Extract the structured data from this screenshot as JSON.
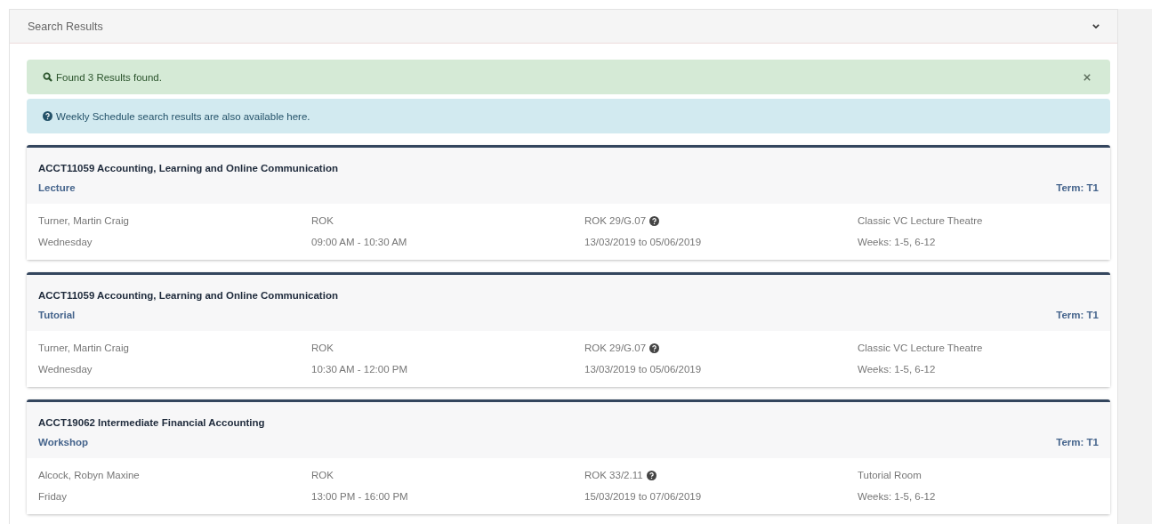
{
  "panel": {
    "title": "Search Results",
    "expanded": true
  },
  "alerts": [
    {
      "kind": "success",
      "text": "Found 3 Results found.",
      "dismissible": true
    },
    {
      "kind": "info",
      "text": "Weekly Schedule search results are also available here.",
      "dismissible": false
    }
  ],
  "results": [
    {
      "course": "ACCT11059 Accounting, Learning and Online Communication",
      "type": "Lecture",
      "term": "Term: T1",
      "instructor": "Turner, Martin Craig",
      "campus": "ROK",
      "room": "ROK 29/G.07",
      "venue": "Classic VC Lecture Theatre",
      "day": "Wednesday",
      "time": "09:00 AM - 10:30 AM",
      "dates": "13/03/2019 to 05/06/2019",
      "weeks": "Weeks: 1-5, 6-12"
    },
    {
      "course": "ACCT11059 Accounting, Learning and Online Communication",
      "type": "Tutorial",
      "term": "Term: T1",
      "instructor": "Turner, Martin Craig",
      "campus": "ROK",
      "room": "ROK 29/G.07",
      "venue": "Classic VC Lecture Theatre",
      "day": "Wednesday",
      "time": "10:30 AM - 12:00 PM",
      "dates": "13/03/2019 to 05/06/2019",
      "weeks": "Weeks: 1-5, 6-12"
    },
    {
      "course": "ACCT19062 Intermediate Financial Accounting",
      "type": "Workshop",
      "term": "Term: T1",
      "instructor": "Alcock, Robyn Maxine",
      "campus": "ROK",
      "room": "ROK 33/2.11",
      "venue": "Tutorial Room",
      "day": "Friday",
      "time": "13:00 PM - 16:00 PM",
      "dates": "15/03/2019 to 07/06/2019",
      "weeks": "Weeks: 1-5, 6-12"
    }
  ]
}
